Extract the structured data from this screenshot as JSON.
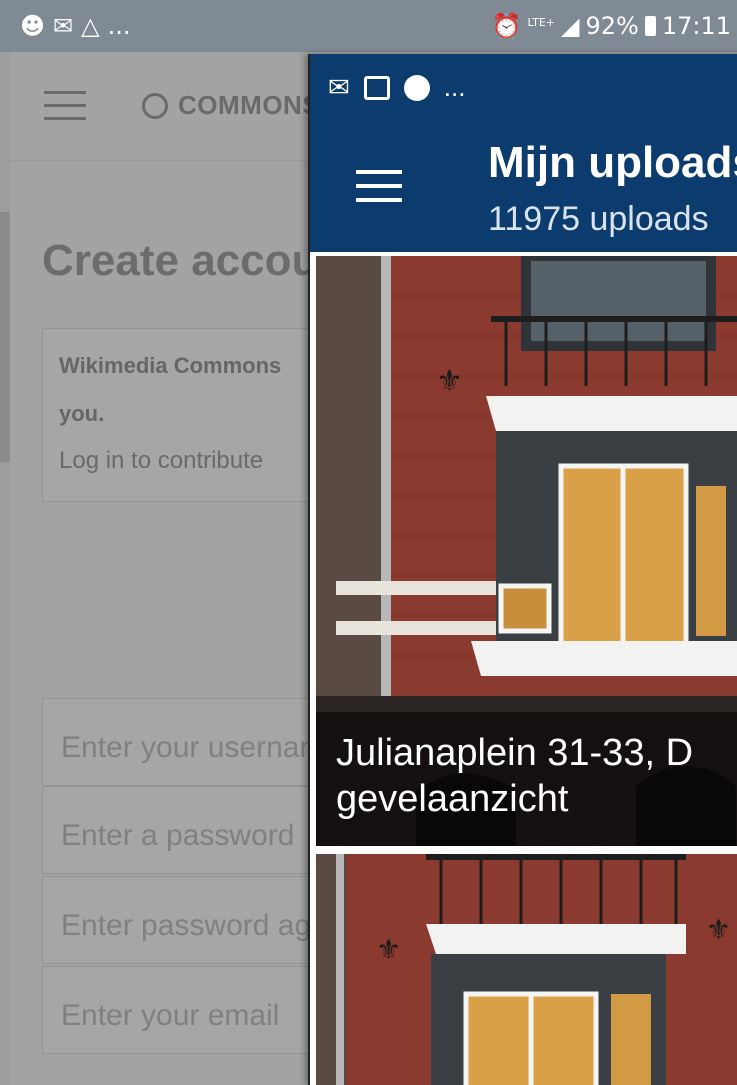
{
  "status_bar": {
    "left_more": "...",
    "battery": "92%",
    "time": "17:11",
    "network": "LTE+",
    "icons": [
      "notification-icon",
      "mail-icon",
      "warning-icon",
      "alarm-icon",
      "signal-icon",
      "battery-icon"
    ]
  },
  "background_app": {
    "brand": "COMMONS",
    "title": "Create account",
    "notice_line1": "Wikimedia Commons",
    "notice_line2": "you.",
    "notice_line3": "Log in to contribute",
    "fields": [
      {
        "placeholder": "Enter your username"
      },
      {
        "placeholder": "Enter a password"
      },
      {
        "placeholder": "Enter password again"
      },
      {
        "placeholder": "Enter your email"
      }
    ]
  },
  "overlay_app": {
    "status_more": "...",
    "title": "Mijn uploads",
    "subtitle": "11975 uploads",
    "colors": {
      "toolbar": "#0c3b6e"
    },
    "uploads": [
      {
        "caption_line1": "Julianaplein 31-33, D",
        "caption_line2": "gevelaanzicht"
      },
      {
        "caption_line1": "",
        "caption_line2": ""
      }
    ]
  }
}
